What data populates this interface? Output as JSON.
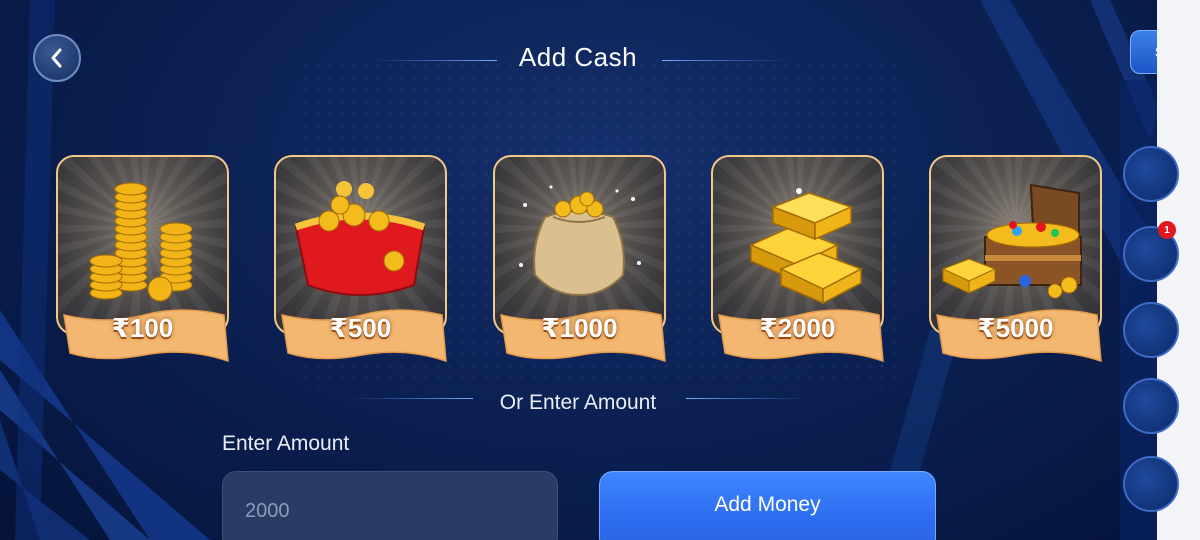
{
  "header": {
    "title": "Add Cash",
    "back_label": "Back"
  },
  "packs": [
    {
      "price": "₹100",
      "art": "coin-stacks"
    },
    {
      "price": "₹500",
      "art": "coin-purse"
    },
    {
      "price": "₹1000",
      "art": "coin-sack"
    },
    {
      "price": "₹2000",
      "art": "gold-bars"
    },
    {
      "price": "₹5000",
      "art": "treasure-chest"
    }
  ],
  "divider_text": "Or Enter Amount",
  "amount_form": {
    "label": "Enter Amount",
    "placeholder": "2000",
    "submit_label": "Add Money"
  },
  "side_panel": {
    "tab_text": "SH",
    "notification_count": "1"
  },
  "colors": {
    "background": "#0c2356",
    "accent": "#2d6df0",
    "ribbon": "#f0b26a",
    "badge": "#e3151e"
  }
}
